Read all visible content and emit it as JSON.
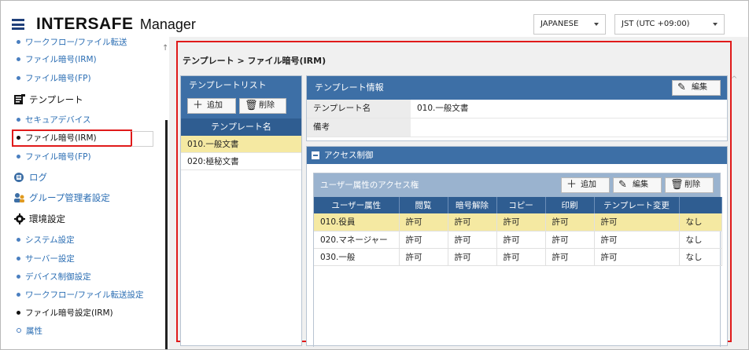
{
  "header": {
    "brand_main": "INTERSAFE",
    "brand_sub": "Manager",
    "language": "JAPANESE",
    "timezone": "JST (UTC +09:00)"
  },
  "sidebar": {
    "items": [
      {
        "label": "ワークフロー/ファイル転送",
        "type": "link"
      },
      {
        "label": "ファイル暗号(IRM)",
        "type": "link"
      },
      {
        "label": "ファイル暗号(FP)",
        "type": "link"
      },
      {
        "label": "テンプレート",
        "type": "section",
        "icon": "template-icon"
      },
      {
        "label": "セキュアデバイス",
        "type": "link"
      },
      {
        "label": "ファイル暗号(IRM)",
        "type": "active"
      },
      {
        "label": "ファイル暗号(FP)",
        "type": "link"
      },
      {
        "label": "ログ",
        "type": "section",
        "icon": "log-icon"
      },
      {
        "label": "グループ管理者設定",
        "type": "section",
        "icon": "group-admin-icon"
      },
      {
        "label": "環境設定",
        "type": "section",
        "icon": "settings-gear-icon"
      },
      {
        "label": "システム設定",
        "type": "link"
      },
      {
        "label": "サーバー設定",
        "type": "link"
      },
      {
        "label": "デバイス制御設定",
        "type": "link"
      },
      {
        "label": "ワークフロー/ファイル転送設定",
        "type": "link"
      },
      {
        "label": "ファイル暗号設定(IRM)",
        "type": "active"
      },
      {
        "label": "属性",
        "type": "sub"
      }
    ]
  },
  "main": {
    "breadcrumb": "テンプレート > ファイル暗号(IRM)",
    "template_list": {
      "title": "テンプレートリスト",
      "add_label": "追加",
      "delete_label": "削除",
      "column": "テンプレート名",
      "rows": [
        "010.一般文書",
        "020:極秘文書"
      ]
    },
    "template_info": {
      "title": "テンプレート情報",
      "edit_label": "編集",
      "name_key": "テンプレート名",
      "name_value": "010.一般文書",
      "note_key": "備考",
      "note_value": ""
    },
    "access": {
      "title": "アクセス制御",
      "subtitle": "ユーザー属性のアクセス権",
      "add_label": "追加",
      "edit_label": "編集",
      "delete_label": "削除",
      "columns": [
        "ユーザー属性",
        "閲覧",
        "暗号解除",
        "コピー",
        "印刷",
        "テンプレート変更",
        ""
      ],
      "rows": [
        [
          "010.役員",
          "許可",
          "許可",
          "許可",
          "許可",
          "許可",
          "なし"
        ],
        [
          "020.マネージャー",
          "許可",
          "許可",
          "許可",
          "許可",
          "許可",
          "なし"
        ],
        [
          "030.一般",
          "許可",
          "許可",
          "許可",
          "許可",
          "許可",
          "なし"
        ]
      ]
    }
  },
  "colors": {
    "accent": "#3d6fa6",
    "header_dark": "#2f5d91",
    "selected_row": "#f5e9a2",
    "highlight_red": "#e01a1a",
    "link_blue": "#2a6db3"
  }
}
